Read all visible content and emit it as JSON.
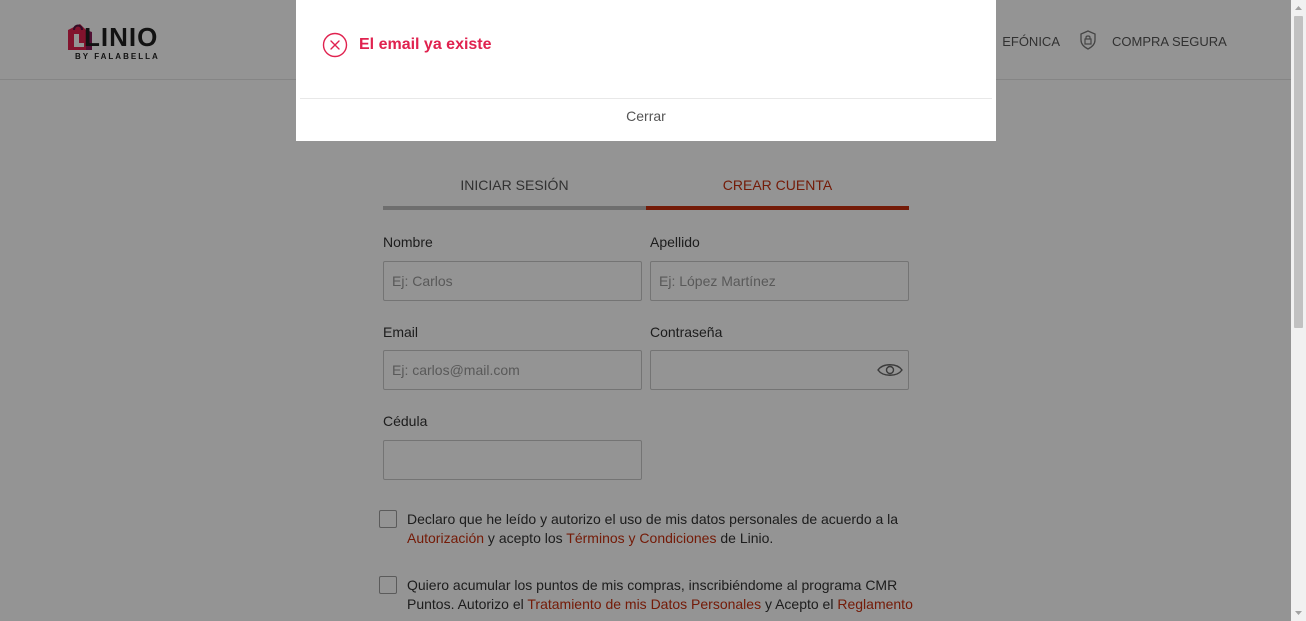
{
  "header": {
    "logo_text": "LINIO",
    "logo_sub": "BY FALABELLA",
    "phone_link": "EFÓNICA",
    "secure_link": "COMPRA SEGURA"
  },
  "tabs": {
    "login": "INICIAR SESIÓN",
    "signup": "CREAR CUENTA"
  },
  "form": {
    "nombre_label": "Nombre",
    "nombre_placeholder": "Ej: Carlos",
    "apellido_label": "Apellido",
    "apellido_placeholder": "Ej: López Martínez",
    "email_label": "Email",
    "email_placeholder": "Ej: carlos@mail.com",
    "password_label": "Contraseña",
    "cedula_label": "Cédula"
  },
  "consent": {
    "c1_part1": "Declaro que he leído y autorizo el uso de mis datos personales de acuerdo a la ",
    "c1_link1": "Autorización",
    "c1_part2": " y acepto los ",
    "c1_link2": "Términos y Condiciones",
    "c1_part3": " de Linio.",
    "c2_part1": "Quiero acumular los puntos de mis compras, inscribiéndome al programa CMR Puntos. Autorizo el ",
    "c2_link1": "Tratamiento de mis Datos Personales",
    "c2_part2": " y Acepto el ",
    "c2_link2": "Reglamento"
  },
  "modal": {
    "title": "El email ya existe",
    "close_label": "Cerrar"
  },
  "colors": {
    "accent": "#c8300f",
    "error": "#e0224f"
  }
}
